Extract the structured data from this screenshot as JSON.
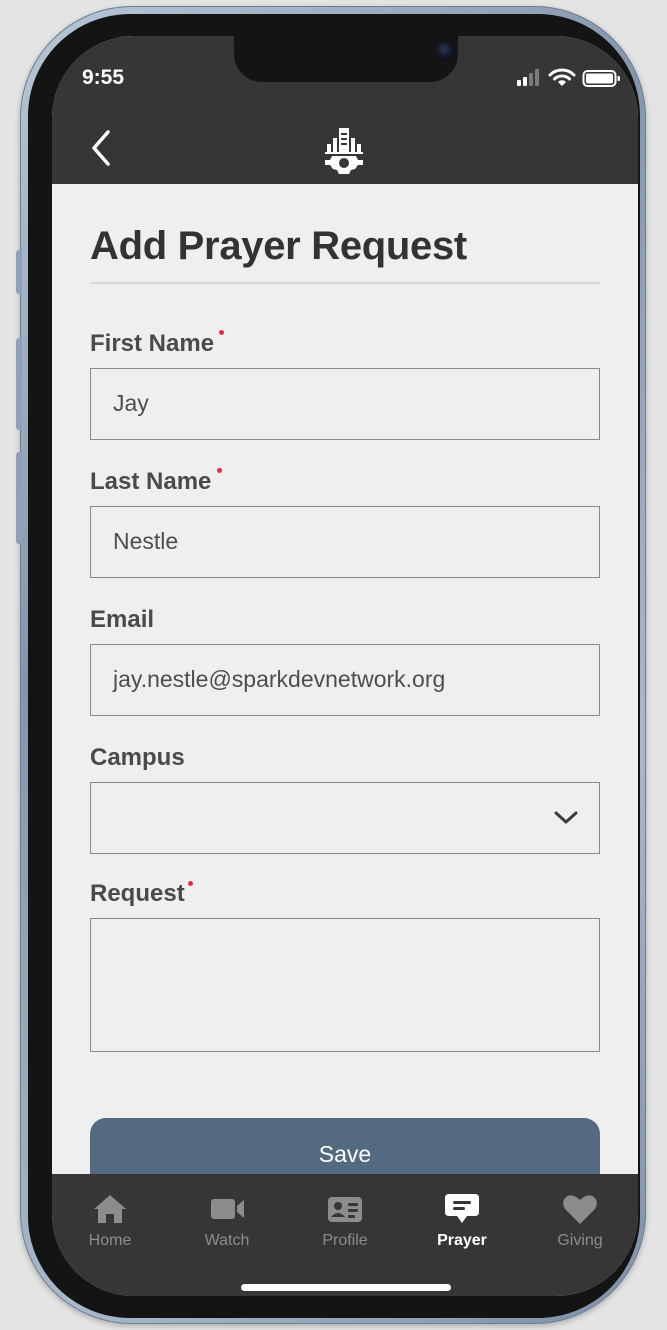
{
  "status_bar": {
    "time": "9:55"
  },
  "header": {
    "back_icon": "chevron-left-icon",
    "logo_icon": "rock-gear-logo"
  },
  "page": {
    "title": "Add Prayer Request"
  },
  "form": {
    "first_name": {
      "label": "First Name",
      "value": "Jay",
      "required": true
    },
    "last_name": {
      "label": "Last Name",
      "value": "Nestle",
      "required": true
    },
    "email": {
      "label": "Email",
      "value": "jay.nestle@sparkdevnetwork.org",
      "required": false
    },
    "campus": {
      "label": "Campus",
      "value": "",
      "required": false
    },
    "request": {
      "label": "Request",
      "value": "",
      "required": true
    },
    "save_label": "Save"
  },
  "tabs": [
    {
      "label": "Home",
      "icon": "home-icon",
      "active": false
    },
    {
      "label": "Watch",
      "icon": "video-camera-icon",
      "active": false
    },
    {
      "label": "Profile",
      "icon": "id-card-icon",
      "active": false
    },
    {
      "label": "Prayer",
      "icon": "chat-bubble-icon",
      "active": true
    },
    {
      "label": "Giving",
      "icon": "heart-icon",
      "active": false
    }
  ],
  "colors": {
    "header_bg": "#363636",
    "content_bg": "#efefef",
    "button_bg": "#546a80",
    "required_dot": "#e0303c",
    "tab_inactive": "#8c8c8c",
    "tab_active": "#ffffff"
  }
}
